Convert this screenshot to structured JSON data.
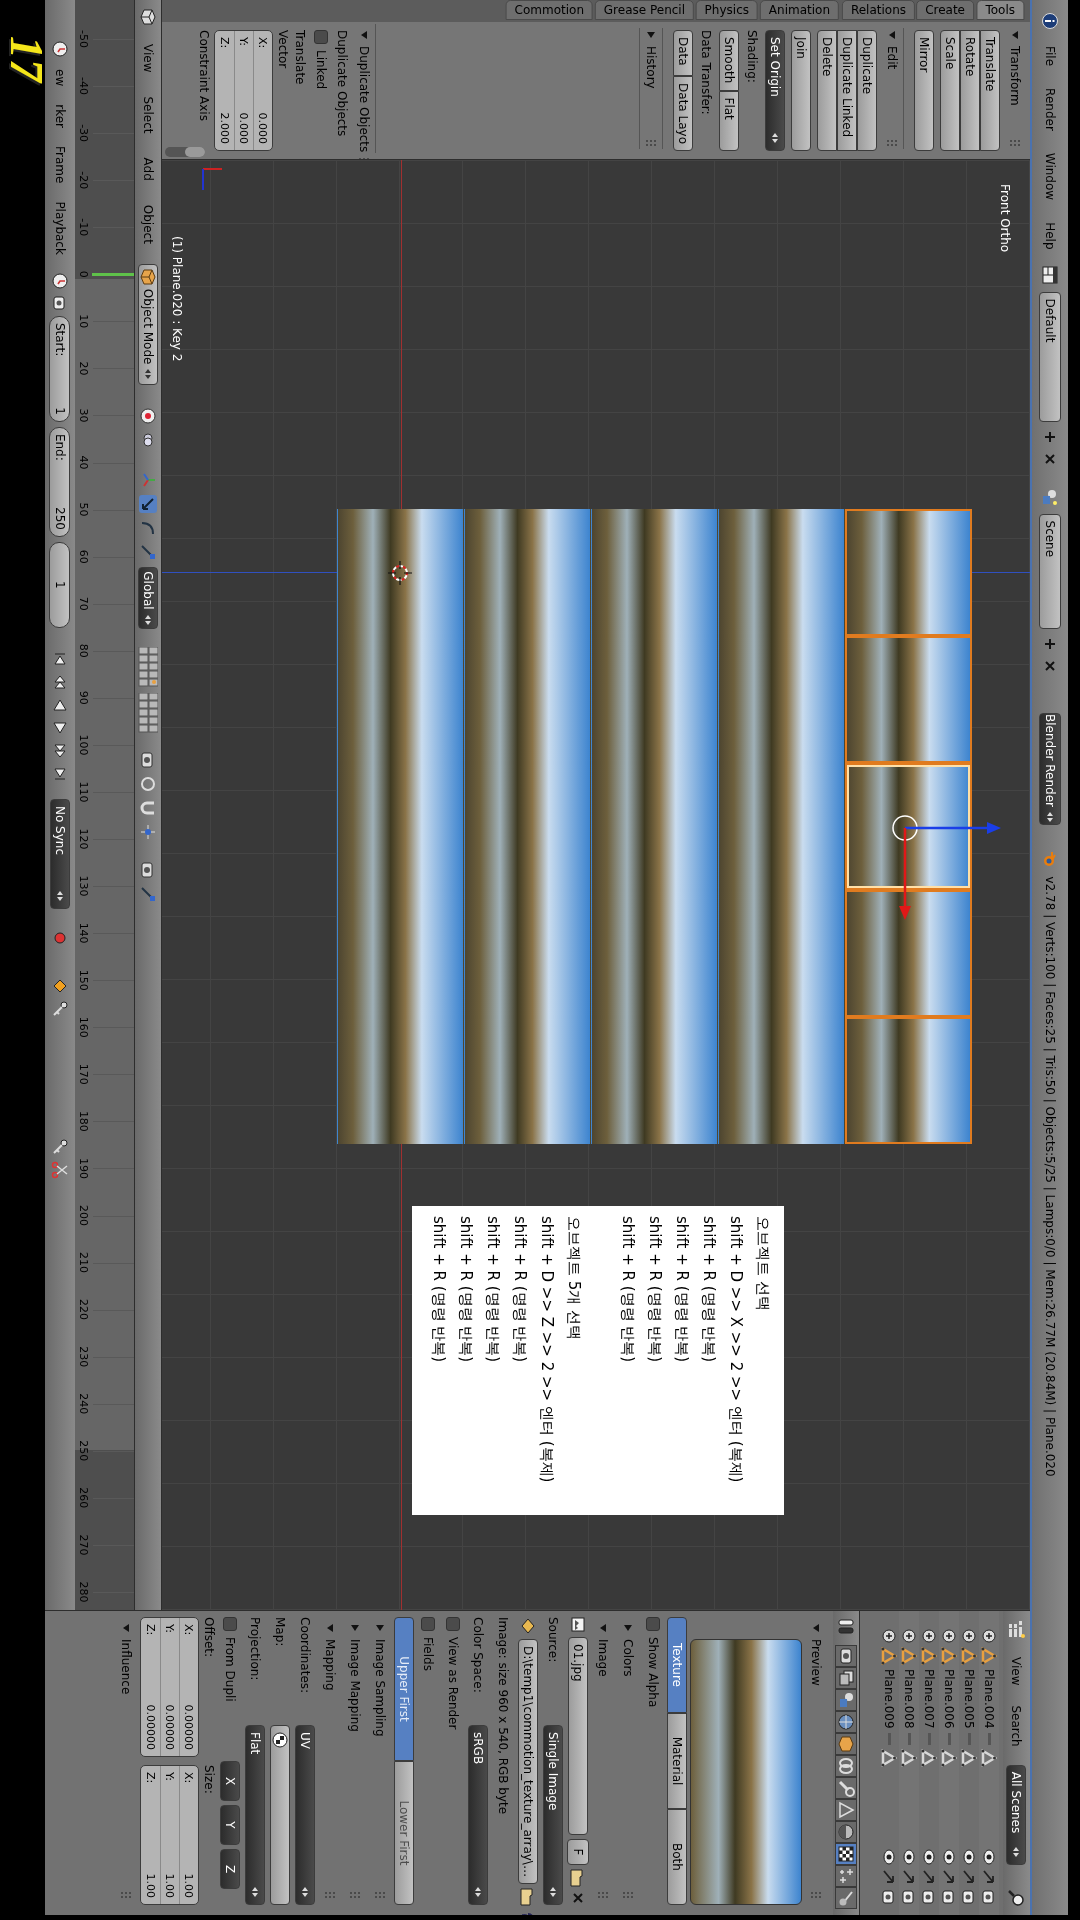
{
  "info_header": {
    "menus": [
      "File",
      "Render",
      "Window",
      "Help"
    ],
    "layout": "Default",
    "scene": "Scene",
    "engine": "Blender Render",
    "status": "v2.78 | Verts:100 | Faces:25 | Tris:50 | Objects:5/25 | Lamps:0/0 | Mem:26.77M (20.84M) | Plane.020"
  },
  "tool_tabs": [
    {
      "label": "Commotion",
      "selected": false
    },
    {
      "label": "Grease Pencil",
      "selected": false
    },
    {
      "label": "Physics",
      "selected": false
    },
    {
      "label": "Animation",
      "selected": false
    },
    {
      "label": "Relations",
      "selected": false
    },
    {
      "label": "Create",
      "selected": false
    },
    {
      "label": "Tools",
      "selected": true
    }
  ],
  "tool_panels": [
    {
      "title": "Transform",
      "expanded": true,
      "rows": [
        {
          "kind": "stack",
          "buttons": [
            "Translate",
            "Rotate",
            "Scale"
          ]
        },
        {
          "kind": "stack",
          "buttons": [
            "Mirror"
          ]
        }
      ]
    },
    {
      "title": "Edit",
      "expanded": true,
      "rows": [
        {
          "kind": "stack",
          "buttons": [
            "Duplicate",
            "Duplicate Linked",
            "Delete"
          ]
        },
        {
          "kind": "stack",
          "buttons": [
            "Join"
          ]
        },
        {
          "kind": "menu",
          "text": "Set Origin"
        },
        {
          "kind": "label",
          "text": "Shading:"
        },
        {
          "kind": "row",
          "buttons": [
            "Smooth",
            "Flat"
          ]
        },
        {
          "kind": "label",
          "text": "Data Transfer:"
        },
        {
          "kind": "row",
          "buttons": [
            "Data",
            "Data Layo"
          ]
        }
      ]
    },
    {
      "title": "History",
      "expanded": false
    }
  ],
  "operator_panel": {
    "title": "Duplicate Objects",
    "expanded": true,
    "rows": [
      {
        "kind": "label",
        "text": "Duplicate Objects"
      },
      {
        "kind": "checkbox",
        "text": "Linked",
        "checked": false
      },
      {
        "kind": "label",
        "text": "Translate"
      },
      {
        "kind": "label",
        "text": "Vector"
      },
      {
        "kind": "vector",
        "fields": [
          {
            "axis": "X:",
            "value": "0.000"
          },
          {
            "axis": "Y:",
            "value": "0.000"
          },
          {
            "axis": "Z:",
            "value": "2.000"
          }
        ]
      },
      {
        "kind": "label",
        "text": "Constraint Axis"
      }
    ]
  },
  "viewport": {
    "view_name": "Front Ortho",
    "object_info": "(1) Plane.020 : Key 2",
    "tiles": [
      {
        "selected": true,
        "active": false
      },
      {
        "selected": true,
        "active": false
      },
      {
        "selected": true,
        "active": true
      },
      {
        "selected": true,
        "active": false
      },
      {
        "selected": true,
        "active": false
      },
      {
        "selected": false,
        "active": false
      },
      {
        "selected": false,
        "active": false
      },
      {
        "selected": false,
        "active": false
      },
      {
        "selected": false,
        "active": false
      },
      {
        "selected": false,
        "active": false
      },
      {
        "selected": false,
        "active": false
      },
      {
        "selected": false,
        "active": false
      },
      {
        "selected": false,
        "active": false
      },
      {
        "selected": false,
        "active": false
      },
      {
        "selected": false,
        "active": false
      },
      {
        "selected": false,
        "active": false
      },
      {
        "selected": false,
        "active": false
      },
      {
        "selected": false,
        "active": false
      },
      {
        "selected": false,
        "active": false
      },
      {
        "selected": false,
        "active": false
      },
      {
        "selected": false,
        "active": false
      },
      {
        "selected": false,
        "active": false
      },
      {
        "selected": false,
        "active": false
      },
      {
        "selected": false,
        "active": false
      },
      {
        "selected": false,
        "active": false
      }
    ]
  },
  "annotation": {
    "groups": [
      [
        "오브젝트 선택",
        "shift + D >> X >> 2 >> 엔터 (복제)",
        "shift + R (명령 반복)",
        "shift + R (명령 반복)",
        "shift + R (명령 반복)",
        "shift + R (명령 반복)"
      ],
      [
        "오브젝트 5개 선택",
        "shift + D >> Z >> 2 >> 엔터 (복제)",
        "shift + R (명령 반복)",
        "shift + R (명령 반복)",
        "shift + R (명령 반복)",
        "shift + R (명령 반복)"
      ]
    ]
  },
  "step_number": "17",
  "view3d_header": {
    "menus": [
      "View",
      "Select",
      "Add",
      "Object"
    ],
    "mode": "Object Mode",
    "orientation": "Global"
  },
  "timeline": {
    "ruler": [
      "-50",
      "-40",
      "-30",
      "-20",
      "-10",
      "0",
      "10",
      "20",
      "30",
      "40",
      "50",
      "60",
      "70",
      "80",
      "90",
      "100",
      "110",
      "120",
      "130",
      "140",
      "150",
      "160",
      "170",
      "180",
      "190",
      "200",
      "210",
      "220",
      "230",
      "240",
      "250",
      "260",
      "270",
      "280"
    ],
    "menus": [
      "ew",
      "rker",
      "Frame",
      "Playback"
    ],
    "start": {
      "label": "Start:",
      "value": "1"
    },
    "end": {
      "label": "End:",
      "value": "250"
    },
    "current": "1",
    "sync": "No Sync"
  },
  "outliner": {
    "menus": [
      "View",
      "Search"
    ],
    "filter": "All Scenes",
    "rows": [
      "Plane.004",
      "Plane.005",
      "Plane.006",
      "Plane.007",
      "Plane.008",
      "Plane.009"
    ]
  },
  "properties": {
    "context_tabs": [
      {
        "kind": "render",
        "selected": false
      },
      {
        "kind": "layers",
        "selected": false
      },
      {
        "kind": "scene",
        "selected": false
      },
      {
        "kind": "world",
        "selected": false
      },
      {
        "kind": "object",
        "selected": false
      },
      {
        "kind": "constraints",
        "selected": false
      },
      {
        "kind": "modifiers",
        "selected": false
      },
      {
        "kind": "data",
        "selected": false
      },
      {
        "kind": "material",
        "selected": false
      },
      {
        "kind": "texture",
        "selected": true
      },
      {
        "kind": "particles",
        "selected": false
      },
      {
        "kind": "physics",
        "selected": false
      }
    ],
    "preview_panel": {
      "title": "Preview",
      "expanded": true
    },
    "texture_tabs": [
      {
        "label": "Texture",
        "selected": true
      },
      {
        "label": "Material",
        "selected": false
      },
      {
        "label": "Both",
        "selected": false
      }
    ],
    "show_alpha": {
      "label": "Show Alpha",
      "checked": false
    },
    "colors_panel": {
      "title": "Colors",
      "expanded": false
    },
    "image_panel": {
      "title": "Image",
      "expanded": true
    },
    "image": {
      "name": "01.jpg",
      "fake_user": "F",
      "source_label": "Source:",
      "source": "Single Image",
      "filepath": "D:\\temp1\\commotion_texture_array\\…",
      "info": "Image: size 960 x 540, RGB byte",
      "color_space_label": "Color Space:",
      "color_space": "sRGB",
      "view_as_render": {
        "label": "View as Render",
        "checked": false
      },
      "fields": {
        "label": "Fields",
        "checked": false
      },
      "field_order": [
        {
          "label": "Upper First",
          "selected": true
        },
        {
          "label": "Lower First",
          "selected": false
        }
      ]
    },
    "sampling_panel": {
      "title": "Image Sampling",
      "expanded": false
    },
    "image_mapping_panel": {
      "title": "Image Mapping",
      "expanded": false
    },
    "mapping_panel": {
      "title": "Mapping",
      "expanded": true
    },
    "mapping": {
      "coordinates_label": "Coordinates:",
      "coordinates": "UV",
      "map_label": "Map:",
      "projection_label": "Projection:",
      "projection": "Flat",
      "from_dupli": {
        "label": "From Dupli",
        "checked": false
      },
      "axes": [
        "X",
        "Y",
        "Z"
      ],
      "offset_label": "Offset:",
      "offset": [
        {
          "axis": "X:",
          "value": "0.00000"
        },
        {
          "axis": "Y:",
          "value": "0.00000"
        },
        {
          "axis": "Z:",
          "value": "0.00000"
        }
      ],
      "size_label": "Size:",
      "size": [
        {
          "axis": "X:",
          "value": "1.00"
        },
        {
          "axis": "Y:",
          "value": "1.00"
        },
        {
          "axis": "Z:",
          "value": "1.00"
        }
      ]
    },
    "influence_panel": {
      "title": "Influence",
      "expanded": true
    }
  }
}
